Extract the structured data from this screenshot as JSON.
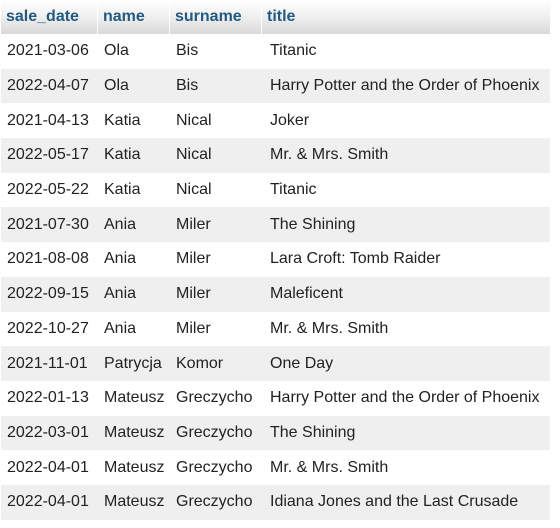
{
  "table": {
    "columns": [
      "sale_date",
      "name",
      "surname",
      "title"
    ],
    "rows": [
      [
        "2021-03-06",
        "Ola",
        "Bis",
        "Titanic"
      ],
      [
        "2022-04-07",
        "Ola",
        "Bis",
        "Harry Potter and the Order of Phoenix"
      ],
      [
        "2021-04-13",
        "Katia",
        "Nical",
        "Joker"
      ],
      [
        "2022-05-17",
        "Katia",
        "Nical",
        "Mr. & Mrs. Smith"
      ],
      [
        "2022-05-22",
        "Katia",
        "Nical",
        "Titanic"
      ],
      [
        "2021-07-30",
        "Ania",
        "Miler",
        "The Shining"
      ],
      [
        "2021-08-08",
        "Ania",
        "Miler",
        "Lara Croft: Tomb Raider"
      ],
      [
        "2022-09-15",
        "Ania",
        "Miler",
        "Maleficent"
      ],
      [
        "2022-10-27",
        "Ania",
        "Miler",
        "Mr. & Mrs. Smith"
      ],
      [
        "2021-11-01",
        "Patrycja",
        "Komor",
        "One Day"
      ],
      [
        "2022-01-13",
        "Mateusz",
        "Greczycho",
        "Harry Potter and the Order of Phoenix"
      ],
      [
        "2022-03-01",
        "Mateusz",
        "Greczycho",
        "The Shining"
      ],
      [
        "2022-04-01",
        "Mateusz",
        "Greczycho",
        "Mr. & Mrs. Smith"
      ],
      [
        "2022-04-01",
        "Mateusz",
        "Greczycho",
        "Idiana Jones and the Last Crusade"
      ]
    ]
  },
  "colors": {
    "header_text": "#235a81",
    "row_odd": "#ffffff",
    "row_even": "#efefef",
    "cell_text": "#222222"
  }
}
